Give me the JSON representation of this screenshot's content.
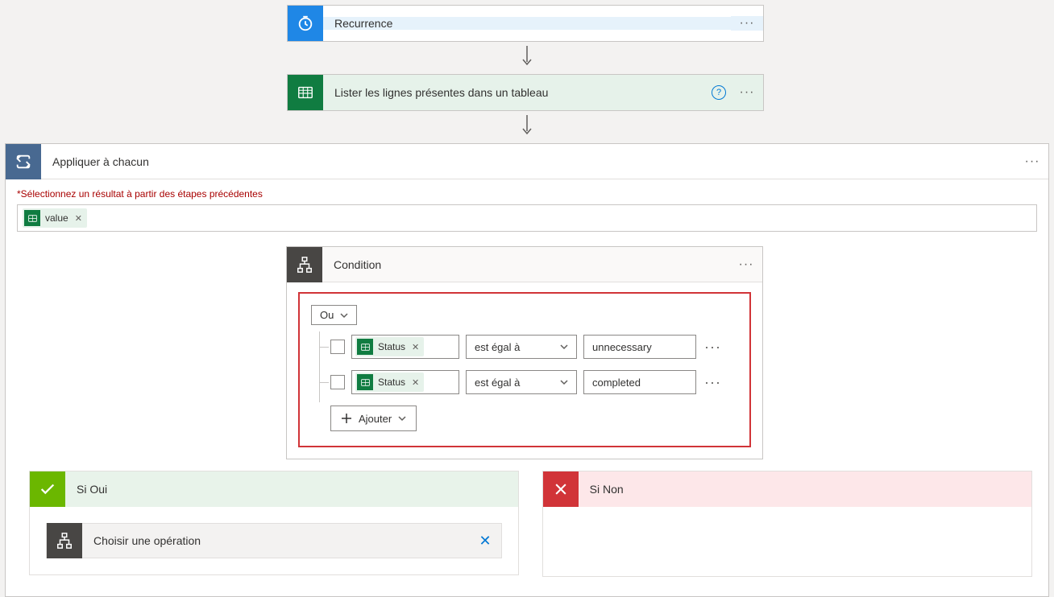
{
  "trigger": {
    "title": "Recurrence"
  },
  "action_list_rows": {
    "title": "Lister les lignes présentes dans un tableau"
  },
  "apply_each": {
    "title": "Appliquer à chacun",
    "select_label_star": "*",
    "select_label": "Sélectionnez un résultat à partir des étapes précédentes",
    "token": "value"
  },
  "condition": {
    "title": "Condition",
    "group_op": "Ou",
    "rows": [
      {
        "field": "Status",
        "operator": "est égal à",
        "value": "unnecessary"
      },
      {
        "field": "Status",
        "operator": "est égal à",
        "value": "completed"
      }
    ],
    "add_label": "Ajouter"
  },
  "branches": {
    "yes": "Si Oui",
    "no": "Si Non",
    "choose_op": "Choisir une opération"
  }
}
